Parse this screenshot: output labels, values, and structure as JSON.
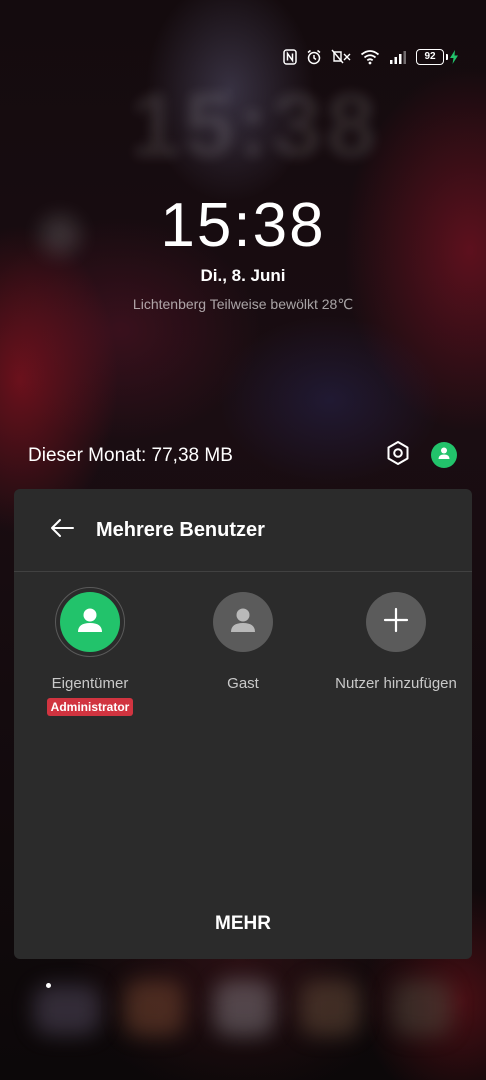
{
  "status_bar": {
    "icons": [
      "nfc-icon",
      "alarm-icon",
      "mute-icon",
      "wifi-icon",
      "signal-icon"
    ],
    "battery_level": "92",
    "charging": true,
    "charging_color": "#22c36b"
  },
  "lockscreen": {
    "time": "15:38",
    "date": "Di., 8. Juni",
    "weather": "Lichtenberg Teilweise bewölkt 28℃"
  },
  "quick_row": {
    "data_usage": "Dieser Monat: 77,38 MB",
    "settings_icon": "settings-icon",
    "user_icon": "user-icon",
    "user_icon_color": "#22c36b"
  },
  "panel": {
    "title": "Mehrere Benutzer",
    "back_icon": "arrow-left-icon",
    "users": [
      {
        "label": "Eigentümer",
        "badge": "Administrator",
        "color": "#22c36b",
        "selected": true
      },
      {
        "label": "Gast",
        "color": "#5b5b5b",
        "selected": false
      },
      {
        "label": "Nutzer hinzufügen",
        "color": "#5b5b5b",
        "icon": "plus-icon"
      }
    ],
    "more_label": "MEHR",
    "badge_color": "#d13440"
  }
}
